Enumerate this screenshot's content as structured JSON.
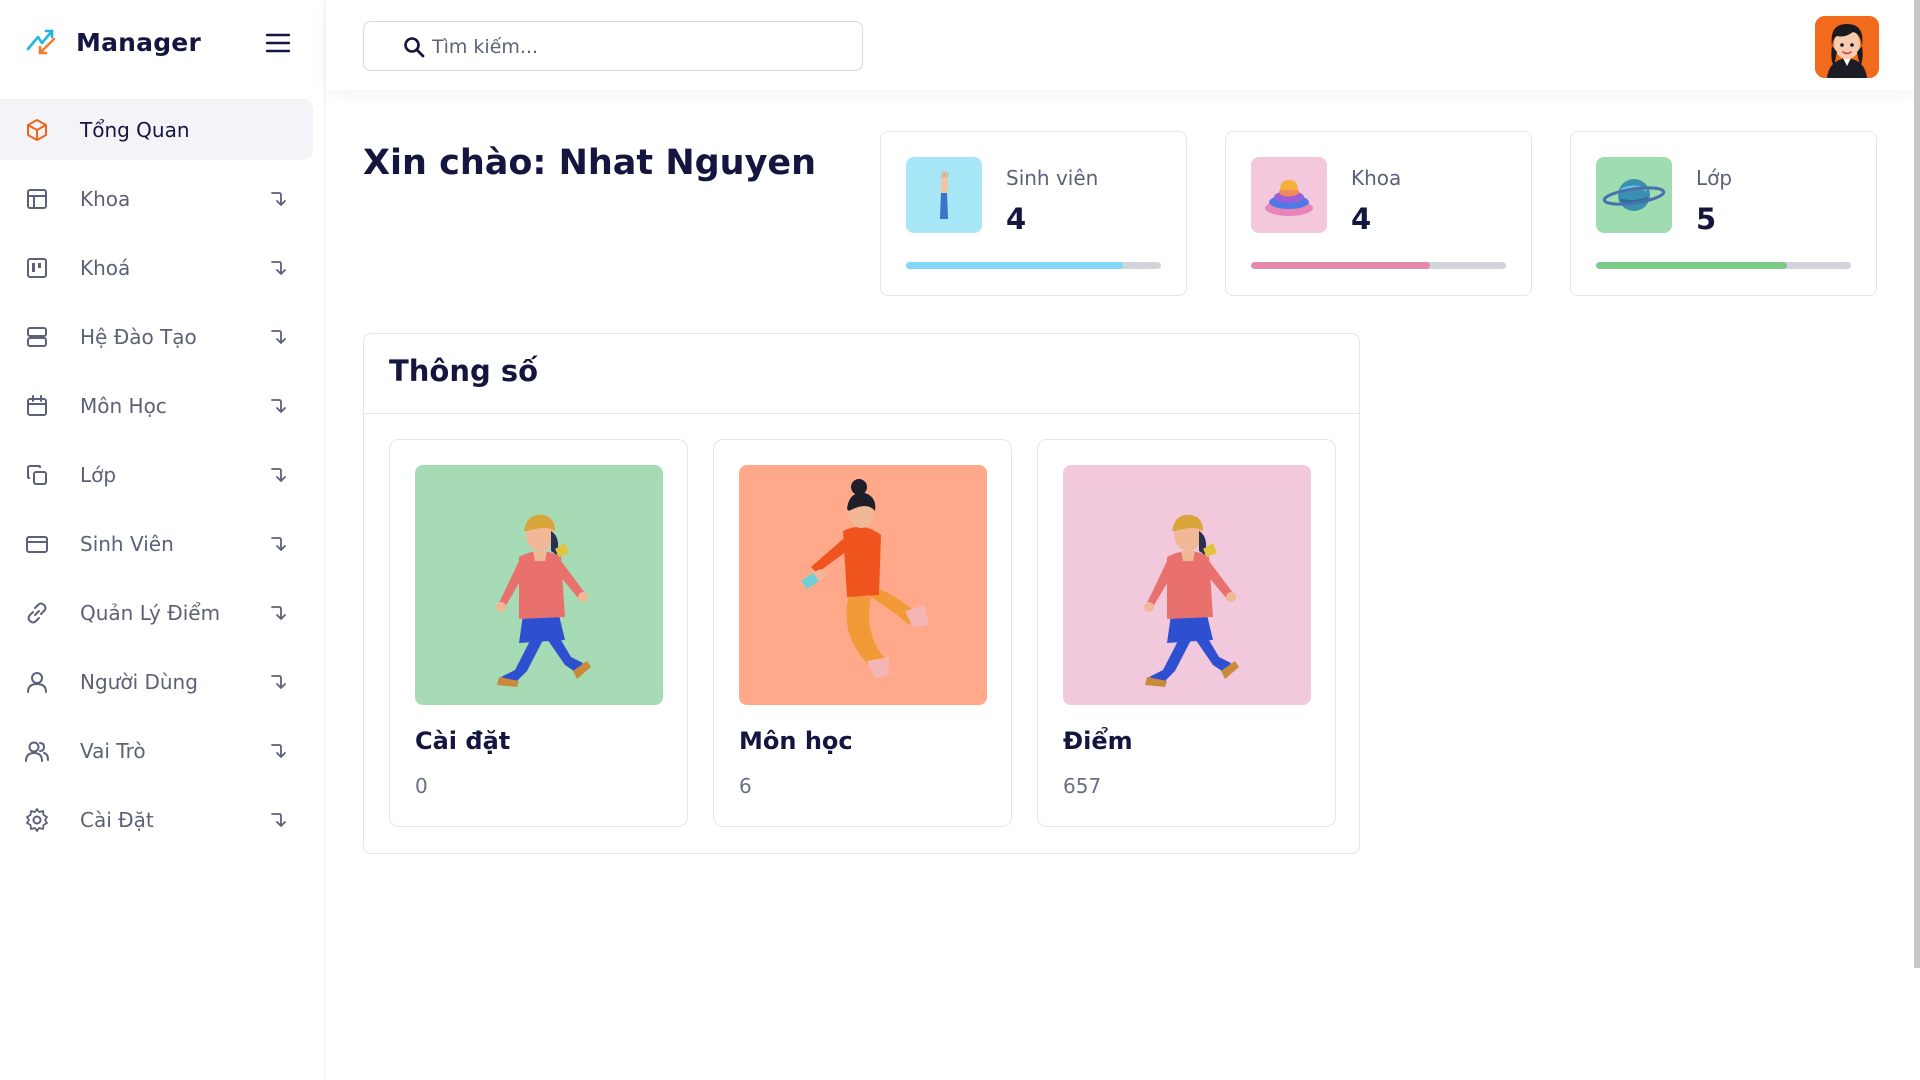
{
  "brand": {
    "name": "Manager"
  },
  "search": {
    "placeholder": "Tìm kiếm..."
  },
  "sidebar": {
    "items": [
      {
        "label": "Tổng Quan",
        "icon": "cube-icon",
        "active": true
      },
      {
        "label": "Khoa",
        "icon": "layout-icon"
      },
      {
        "label": "Khoá",
        "icon": "kanban-icon"
      },
      {
        "label": "Hệ Đào Tạo",
        "icon": "server-icon"
      },
      {
        "label": "Môn Học",
        "icon": "calendar-icon"
      },
      {
        "label": "Lớp",
        "icon": "copy-icon"
      },
      {
        "label": "Sinh Viên",
        "icon": "credit-card-icon"
      },
      {
        "label": "Quản Lý Điểm",
        "icon": "link-icon"
      },
      {
        "label": "Người Dùng",
        "icon": "user-icon"
      },
      {
        "label": "Vai Trò",
        "icon": "users-icon"
      },
      {
        "label": "Cài Đặt",
        "icon": "settings-icon"
      }
    ]
  },
  "main": {
    "greeting": "Xin chào: Nhat Nguyen",
    "stats": [
      {
        "label": "Sinh viên",
        "value": "4",
        "progress": 0.85,
        "color": "#7fd8f5",
        "bg": "#a7e6f7",
        "icon": "raised-arm-icon"
      },
      {
        "label": "Khoa",
        "value": "4",
        "progress": 0.7,
        "color": "#e589ab",
        "bg": "#f4c8dc",
        "icon": "stacked-discs-icon"
      },
      {
        "label": "Lớp",
        "value": "5",
        "progress": 0.75,
        "color": "#7ccb8b",
        "bg": "#9fdcb0",
        "icon": "planet-icon"
      }
    ],
    "panel": {
      "title": "Thông số",
      "tiles": [
        {
          "title": "Cài đặt",
          "value": "0",
          "bg": "#a6dbb6",
          "illustration": "walking-person-illustration"
        },
        {
          "title": "Môn học",
          "value": "6",
          "bg": "#ffa98a",
          "illustration": "jumping-person-illustration"
        },
        {
          "title": "Điểm",
          "value": "657",
          "bg": "#f2c8dc",
          "illustration": "walking-person-illustration"
        }
      ]
    }
  },
  "colors": {
    "primary_text": "#151640",
    "muted_text": "#5d6178",
    "accent_orange": "#f26a1b"
  }
}
